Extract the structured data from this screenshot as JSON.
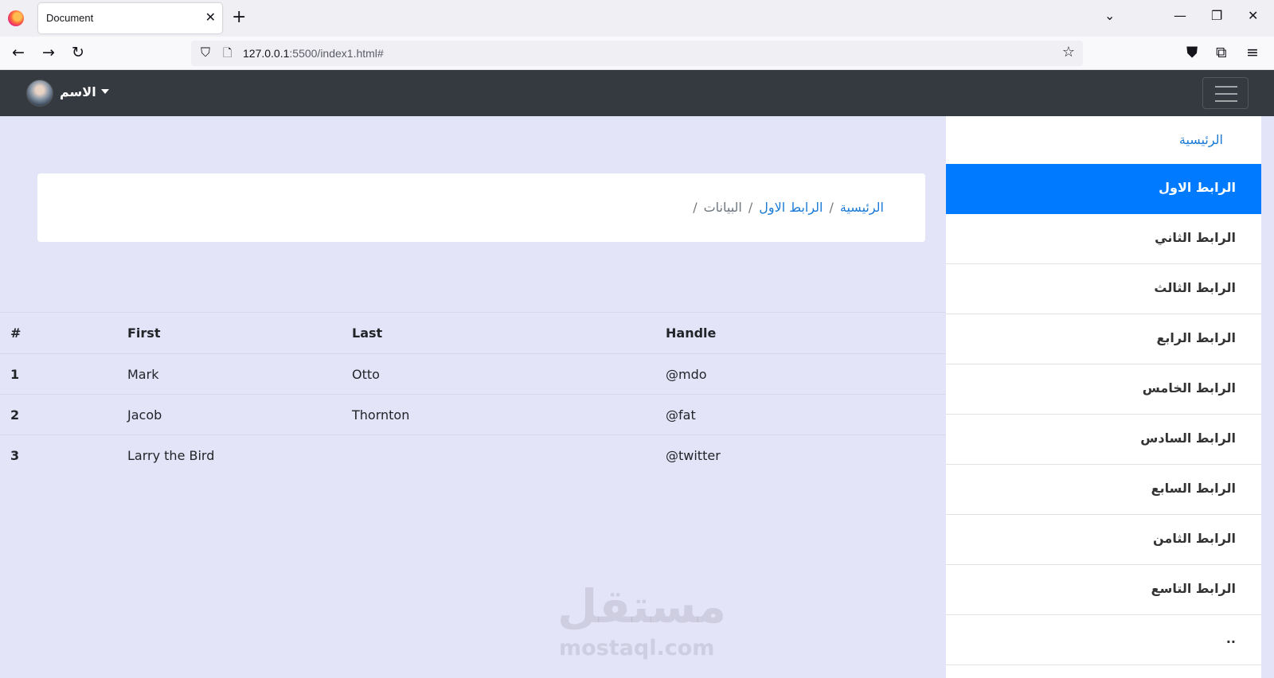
{
  "browser": {
    "tab_title": "Document",
    "tab_close": "✕",
    "new_tab": "+",
    "url_host": "127.0.0.1",
    "url_rest": ":5500/index1.html#",
    "icons": [
      "firefox-logo",
      "back-icon",
      "forward-icon",
      "reload-icon",
      "shield-icon",
      "page-icon",
      "star-icon",
      "pocket-icon",
      "extensions-icon",
      "menu-icon",
      "list-tabs-icon",
      "minimize-icon",
      "restore-icon",
      "close-icon"
    ]
  },
  "site_nav": {
    "user_name": "الاسم",
    "background": "#343a40"
  },
  "sidebar": {
    "home": "الرئيسية",
    "items": [
      {
        "label": "الرابط الاول",
        "active": true
      },
      {
        "label": "الرابط الثاني",
        "active": false
      },
      {
        "label": "الرابط الثالث",
        "active": false
      },
      {
        "label": "الرابط الرابع",
        "active": false
      },
      {
        "label": "الرابط الخامس",
        "active": false
      },
      {
        "label": "الرابط السادس",
        "active": false
      },
      {
        "label": "الرابط السابع",
        "active": false
      },
      {
        "label": "الرابط الثامن",
        "active": false
      },
      {
        "label": "الرابط التاسع",
        "active": false
      },
      {
        "label": "..",
        "active": false
      }
    ],
    "active_color": "#007bff"
  },
  "breadcrumb": {
    "items": [
      "الرئيسية",
      "الرابط الاول"
    ],
    "current": "البيانات",
    "separator": "/"
  },
  "table": {
    "headers": [
      "#",
      "First",
      "Last",
      "Handle"
    ],
    "rows": [
      [
        "1",
        "Mark",
        "Otto",
        "@mdo"
      ],
      [
        "2",
        "Jacob",
        "Thornton",
        "@fat"
      ],
      [
        "3",
        "Larry the Bird",
        "",
        "@twitter"
      ]
    ]
  },
  "watermark": {
    "arabic": "مستقل",
    "latin": "mostaql.com"
  }
}
